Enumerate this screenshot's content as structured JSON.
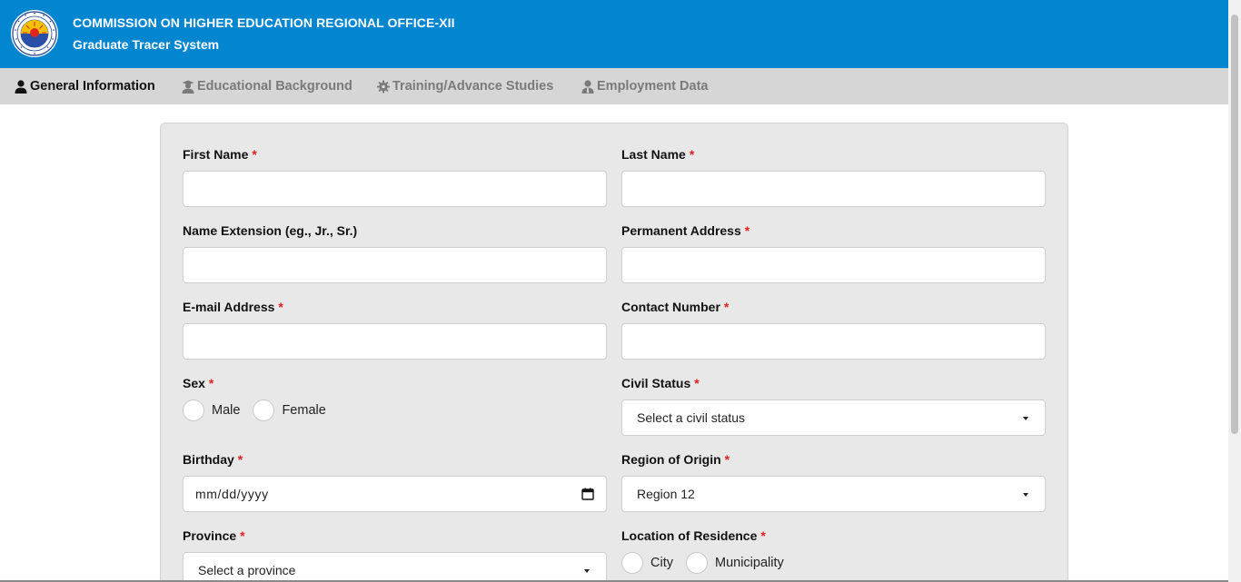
{
  "header": {
    "title": "COMMISSION ON HIGHER EDUCATION REGIONAL OFFICE-XII",
    "subtitle": "Graduate Tracer System",
    "brand_color": "#0286d0"
  },
  "tabs": [
    {
      "label": "General Information",
      "icon": "user-icon",
      "active": true
    },
    {
      "label": "Educational Background",
      "icon": "graduate-icon",
      "active": false
    },
    {
      "label": "Training/Advance Studies",
      "icon": "gear-icon",
      "active": false
    },
    {
      "label": "Employment Data",
      "icon": "user-tie-icon",
      "active": false
    }
  ],
  "form": {
    "required_mark": "*",
    "first_name": {
      "label": "First Name",
      "value": ""
    },
    "last_name": {
      "label": "Last Name",
      "value": ""
    },
    "name_extension": {
      "label": "Name Extension (eg., Jr., Sr.)",
      "value": ""
    },
    "permanent_address": {
      "label": "Permanent Address",
      "value": ""
    },
    "email": {
      "label": "E-mail Address",
      "value": ""
    },
    "contact_number": {
      "label": "Contact Number",
      "value": ""
    },
    "sex": {
      "label": "Sex",
      "options": [
        "Male",
        "Female"
      ]
    },
    "civil_status": {
      "label": "Civil Status",
      "selected": "Select a civil status"
    },
    "birthday": {
      "label": "Birthday",
      "placeholder": "mm/dd/yyyy"
    },
    "region_of_origin": {
      "label": "Region of Origin",
      "selected": "Region 12"
    },
    "province": {
      "label": "Province",
      "selected": "Select a province"
    },
    "location_of_residence": {
      "label": "Location of Residence",
      "options": [
        "City",
        "Municipality"
      ]
    }
  }
}
